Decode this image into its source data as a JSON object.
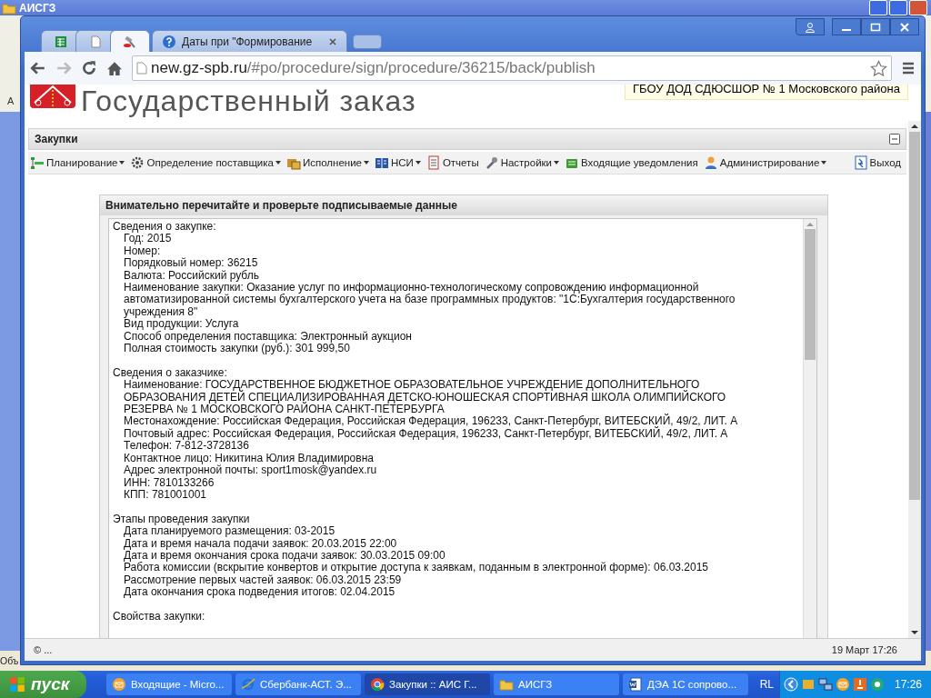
{
  "background_window": {
    "title": "АИСГЗ",
    "side_letter": "А",
    "status_text": "Объ"
  },
  "browser": {
    "tabs": [
      {
        "selected": false
      },
      {
        "selected": false
      },
      {
        "selected": true
      },
      {
        "label": "Даты при \"Формирование",
        "selected": false
      }
    ],
    "url": {
      "host": "new.gz-spb.ru",
      "path": "/#po/procedure/sign/procedure/36215/back/publish"
    }
  },
  "page": {
    "logo_text": "Государственный заказ",
    "org_badge": "ГБОУ ДОД СДЮСШОР № 1 Московского района",
    "panel_title": "Закупки",
    "menu": [
      {
        "label": "Планирование",
        "dropdown": true
      },
      {
        "label": "Определение поставщика",
        "dropdown": true
      },
      {
        "label": "Исполнение",
        "dropdown": true
      },
      {
        "label": "НСИ",
        "dropdown": true
      },
      {
        "label": "Отчеты",
        "dropdown": false
      },
      {
        "label": "Настройки",
        "dropdown": true
      },
      {
        "label": "Входящие уведомления",
        "dropdown": false
      },
      {
        "label": "Администрирование",
        "dropdown": true
      }
    ],
    "exit": "Выход",
    "dialog": {
      "title": "Внимательно перечитайте и проверьте подписываемые данные",
      "sections": [
        {
          "title": "Сведения о закупке:",
          "items": [
            "Год: 2015",
            "Номер:",
            "Порядковый номер: 36215",
            "Валюта: Российский рубль",
            "Наименование закупки: Оказание услуг по информационно-технологическому сопровождению информационной автоматизированной системы бухгалтерского учета на базе программных продуктов: \"1С:Бухгалтерия государственного учреждения 8\"",
            "Вид продукции: Услуга",
            "Способ определения поставщика: Электронный аукцион",
            "Полная стоимость закупки (руб.): 301 999,50"
          ]
        },
        {
          "title": "Сведения о заказчике:",
          "items": [
            "Наименование: ГОСУДАРСТВЕННОЕ БЮДЖЕТНОЕ ОБРАЗОВАТЕЛЬНОЕ УЧРЕЖДЕНИЕ ДОПОЛНИТЕЛЬНОГО ОБРАЗОВАНИЯ ДЕТЕЙ СПЕЦИАЛИЗИРОВАННАЯ ДЕТСКО-ЮНОШЕСКАЯ СПОРТИВНАЯ ШКОЛА ОЛИМПИЙСКОГО РЕЗЕРВА № 1 МОСКОВСКОГО РАЙОНА САНКТ-ПЕТЕРБУРГА",
            "Местонахождение: Российская Федерация, Российская Федерация, 196233, Санкт-Петербург, ВИТЕБСКИЙ, 49/2, ЛИТ. А",
            "Почтовый адрес: Российская Федерация, Российская Федерация, 196233, Санкт-Петербург, ВИТЕБСКИЙ, 49/2, ЛИТ. А",
            "Телефон: 7-812-3728136",
            "Контактное лицо: Никитина Юлия Владимировна",
            "Адрес электронной почты: sport1mosk@yandex.ru",
            "ИНН: 7810133266",
            "КПП: 781001001"
          ]
        },
        {
          "title": "Этапы проведения закупки",
          "items": [
            "Дата планируемого размещения: 03-2015",
            "Дата и время начала подачи заявок: 20.03.2015 22:00",
            "Дата и время окончания срока подачи заявок: 30.03.2015 09:00",
            "Работа комиссии (вскрытие конвертов и открытие доступа к заявкам, поданным в электронной форме): 06.03.2015",
            "Рассмотрение первых частей заявок: 06.03.2015 23:59",
            "Дата окончания срока подведения итогов: 02.04.2015"
          ]
        },
        {
          "title": "Свойства закупки:"
        }
      ]
    },
    "footer": {
      "copyright": "© ...",
      "datetime": "19 Март 17:26"
    }
  },
  "taskbar": {
    "start": "пуск",
    "items": [
      {
        "label": "Входящие - Micro...",
        "selected": false
      },
      {
        "label": "Сбербанк-АСТ. Э...",
        "selected": false
      },
      {
        "label": "Закупки :: АИС Г...",
        "selected": true
      },
      {
        "label": "АИСГЗ",
        "selected": false
      },
      {
        "label": "ДЭА 1С сопрово...",
        "selected": false
      }
    ],
    "language": "RL",
    "clock": "17:26"
  }
}
